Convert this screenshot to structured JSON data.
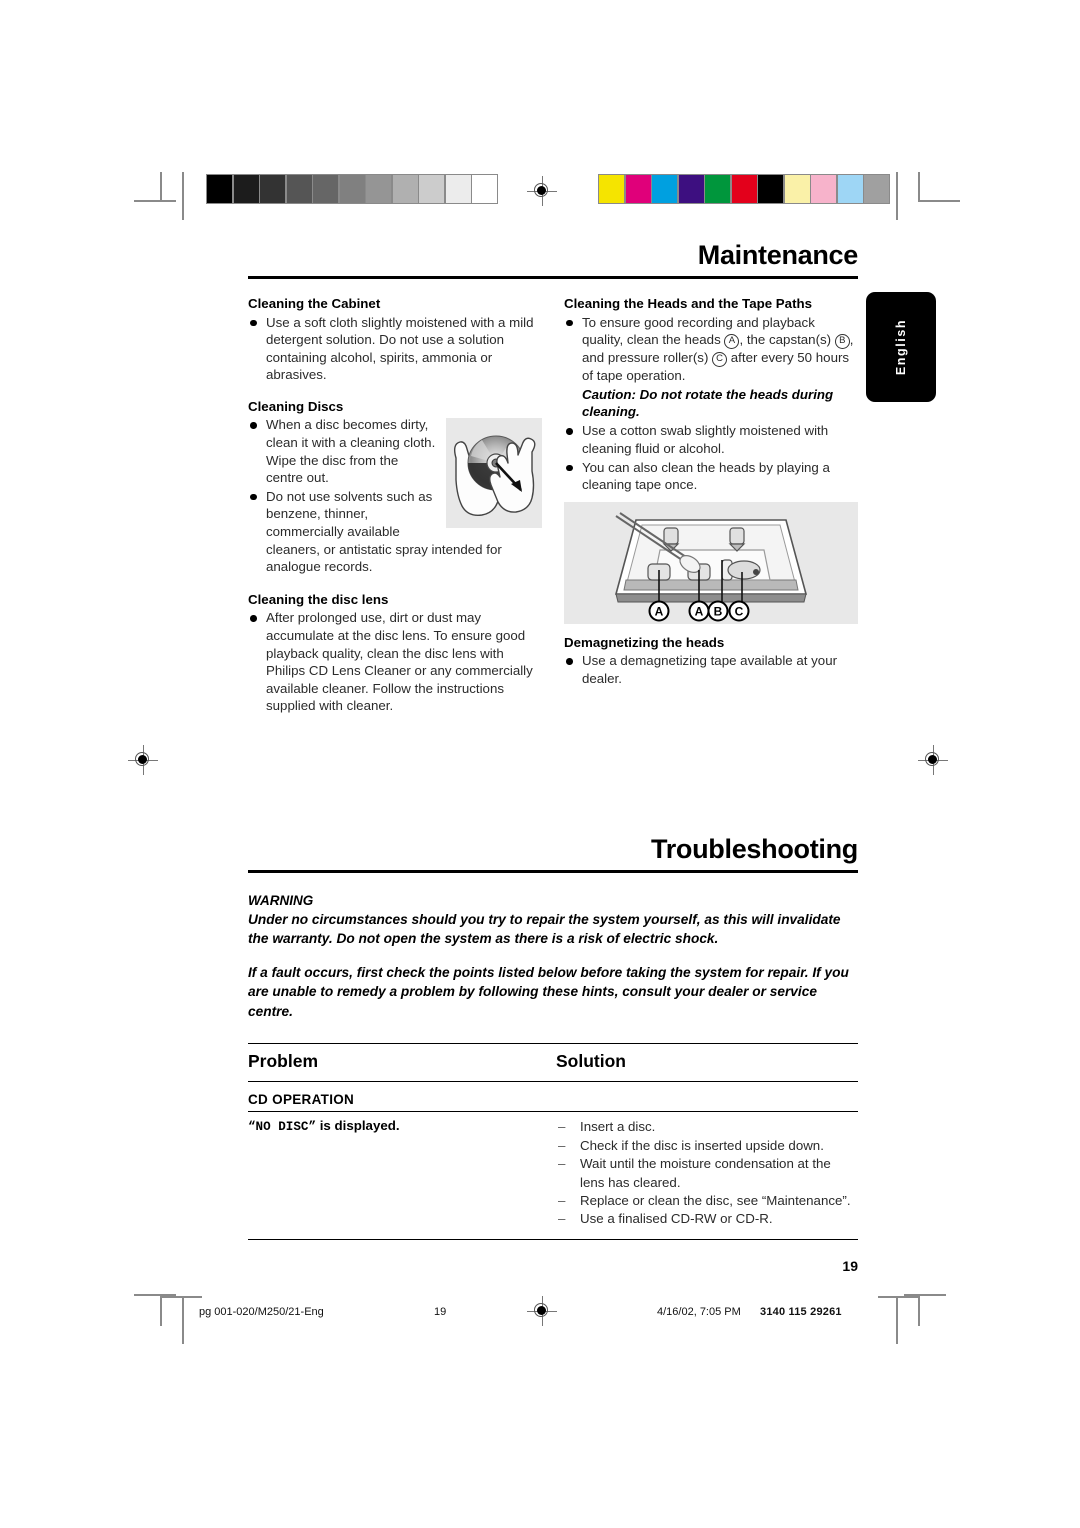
{
  "document": {
    "page_number": "19",
    "language_tab": "English"
  },
  "maintenance": {
    "title": "Maintenance",
    "left_column": {
      "cabinet": {
        "heading": "Cleaning the Cabinet",
        "bullets": [
          "Use a soft cloth slightly moistened with a mild detergent solution. Do not use a solution containing alcohol, spirits, ammonia or abrasives."
        ]
      },
      "discs": {
        "heading": "Cleaning Discs",
        "bullets": [
          "When a disc becomes dirty, clean it with a cleaning cloth. Wipe the disc from the centre out.",
          "Do not use solvents such as benzene, thinner, commercially available cleaners, or antistatic spray intended for analogue records."
        ]
      },
      "disc_lens": {
        "heading": "Cleaning the disc lens",
        "bullets": [
          "After prolonged use, dirt or dust may accumulate at the disc lens. To ensure good playback quality, clean the disc lens with Philips CD Lens Cleaner or any commercially available cleaner. Follow the instructions supplied with cleaner."
        ]
      }
    },
    "right_column": {
      "heads": {
        "heading": "Cleaning the Heads and the Tape Paths",
        "bullet_intro_1": "To ensure good recording and playback quality, clean the heads",
        "label_a": "A",
        "bullet_intro_2": ", the capstan(s)",
        "label_b": "B",
        "bullet_intro_3": ", and pressure roller(s)",
        "label_c": "C",
        "bullet_intro_4": "after every 50 hours of tape operation.",
        "caution": "Caution: Do not rotate the heads during cleaning.",
        "bullets": [
          "Use a cotton swab slightly moistened with cleaning fluid or alcohol.",
          "You can also clean the heads by playing a cleaning tape once."
        ],
        "figure_labels": [
          "A",
          "A",
          "B",
          "C"
        ]
      },
      "demagnetizing": {
        "heading": "Demagnetizing the heads",
        "bullets": [
          "Use a demagnetizing tape available at your dealer."
        ]
      }
    }
  },
  "troubleshooting": {
    "title": "Troubleshooting",
    "warning_label": "WARNING",
    "warning_paragraph_1": "Under no circumstances should you try to repair the system yourself, as this will invalidate the warranty.  Do not open the system as there is a risk of electric shock.",
    "warning_paragraph_2": "If a fault occurs, first check the points listed below before taking the system for repair. If you are unable to remedy a problem by following these hints, consult your dealer or service centre.",
    "table": {
      "headers": {
        "problem": "Problem",
        "solution": "Solution"
      },
      "group_label": "CD OPERATION",
      "rows": [
        {
          "problem_code": "“NO DISC”",
          "problem_text": "is displayed.",
          "solutions": [
            "Insert a disc.",
            "Check if the disc is inserted upside down.",
            "Wait until the moisture condensation at the lens has cleared.",
            "Replace or clean the disc, see “Maintenance”.",
            "Use a finalised CD-RW or CD-R."
          ]
        }
      ]
    }
  },
  "footer": {
    "file": "pg 001-020/M250/21-Eng",
    "page": "19",
    "date": "4/16/02, 7:05 PM",
    "code": "3140 115 29261"
  },
  "print_marks": {
    "grayscale_swatches": [
      "#000000",
      "#1c1c1c",
      "#333333",
      "#555555",
      "#666666",
      "#808080",
      "#959595",
      "#b0b0b0",
      "#cccccc",
      "#ececec",
      "#ffffff"
    ],
    "color_swatches": [
      "#f5e400",
      "#e0007a",
      "#00a0e0",
      "#3d0f80",
      "#00963c",
      "#e3001b",
      "#000000",
      "#faf1a8",
      "#f7b3cb",
      "#9ed6f5",
      "#a0a0a0"
    ]
  }
}
